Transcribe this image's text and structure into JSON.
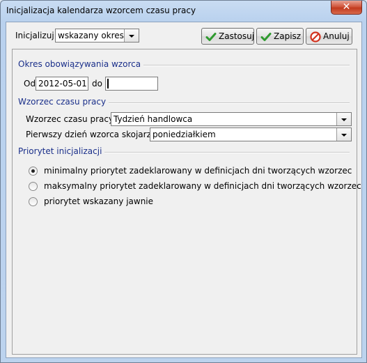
{
  "window": {
    "title": "Inicjalizacja kalendarza wzorcem czasu pracy",
    "close_glyph": "✕"
  },
  "toolbar": {
    "init_label": "Inicjalizuj",
    "init_value": "wskazany okres",
    "apply_label": "Zastosuj",
    "save_label": "Zapisz",
    "cancel_label": "Anuluj"
  },
  "period": {
    "heading": "Okres obowiązywania wzorca",
    "from_label": "Od",
    "from_value": "2012-05-01",
    "to_label": "do",
    "to_value": ""
  },
  "pattern": {
    "heading": "Wzorzec czasu pracy",
    "pattern_label": "Wzorzec czasu pracy:",
    "pattern_value": "Tydzień handlowca",
    "first_day_label": "Pierwszy dzień wzorca skojarz z:",
    "first_day_value": "poniedziałkiem"
  },
  "priority": {
    "heading": "Priorytet inicjalizacji",
    "options": [
      {
        "label": "minimalny priorytet zadeklarowany w definicjach dni tworzących wzorzec",
        "selected": true
      },
      {
        "label": "maksymalny priorytet zadeklarowany w definicjach dni tworzących wzorzec",
        "selected": false
      },
      {
        "label": "priorytet wskazany jawnie",
        "selected": false
      }
    ]
  },
  "colors": {
    "section_heading": "#1a2f8a",
    "check_green": "#2e9a2e",
    "cancel_red": "#d2321e"
  }
}
